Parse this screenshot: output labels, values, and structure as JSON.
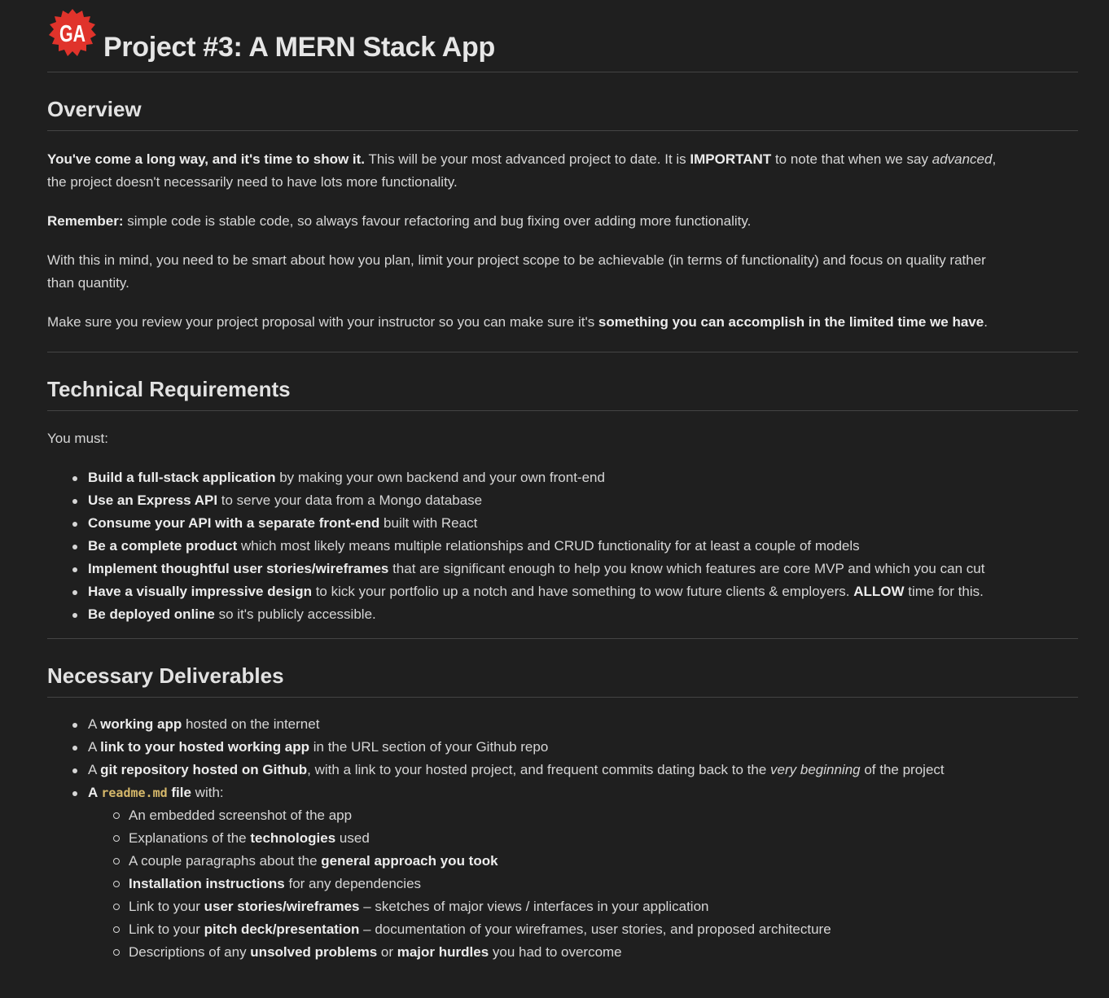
{
  "header": {
    "title": "Project #3: A MERN Stack App",
    "logo_icon": "ga-badge-icon",
    "logo_text": "GA",
    "logo_color": "#e0332b"
  },
  "overview": {
    "heading": "Overview",
    "p1": {
      "bold_lead": "You've come a long way, and it's time to show it.",
      "text_a": " This will be your most advanced project to date. It is ",
      "bold_important": "IMPORTANT",
      "text_b": " to note that when we say ",
      "italic_advanced": "advanced",
      "text_c": ",",
      "line2": "the project doesn't necessarily need to have lots more functionality."
    },
    "p2": {
      "bold_lead": "Remember:",
      "text": " simple code is stable code, so always favour refactoring and bug fixing over adding more functionality."
    },
    "p3": {
      "line1": "With this in mind, you need to be smart about how you plan, limit your project scope to be achievable (in terms of functionality) and focus on quality rather",
      "line2": "than quantity."
    },
    "p4": {
      "text": "Make sure you review your project proposal with your instructor so you can make sure it's ",
      "bold": "something you can accomplish in the limited time we have",
      "end": "."
    }
  },
  "technical": {
    "heading": "Technical Requirements",
    "intro": "You must:",
    "items": [
      {
        "bold": "Build a full-stack application",
        "text": " by making your own backend and your own front-end"
      },
      {
        "bold": "Use an Express API",
        "text": " to serve your data from a Mongo database"
      },
      {
        "bold": "Consume your API with a separate front-end",
        "text": " built with React"
      },
      {
        "bold": "Be a complete product",
        "text": " which most likely means multiple relationships and CRUD functionality for at least a couple of models"
      },
      {
        "bold": "Implement thoughtful user stories/wireframes",
        "text": " that are significant enough to help you know which features are core MVP and which you can cut"
      },
      {
        "bold": "Have a visually impressive design",
        "text": " to kick your portfolio up a notch and have something to wow future clients & employers. ",
        "bold2": "ALLOW",
        "text2": " time for this."
      },
      {
        "bold": "Be deployed online",
        "text": " so it's publicly accessible."
      }
    ]
  },
  "deliverables": {
    "heading": "Necessary Deliverables",
    "items": [
      {
        "pre": "A ",
        "bold": "working app",
        "text": " hosted on the internet"
      },
      {
        "pre": "A ",
        "bold": "link to your hosted working app",
        "text": " in the URL section of your Github repo"
      },
      {
        "pre": "A ",
        "bold": "git repository hosted on Github",
        "text": ", with a link to your hosted project, and frequent commits dating back to the ",
        "italic": "very beginning",
        "text2": " of the project"
      },
      {
        "pre": "A ",
        "code": "readme.md",
        "bold": " file",
        "text": " with:"
      }
    ],
    "sub_items": [
      {
        "text": "An embedded screenshot of the app"
      },
      {
        "pre": "Explanations of the ",
        "bold": "technologies",
        "text": " used"
      },
      {
        "pre": "A couple paragraphs about the ",
        "bold": "general approach you took",
        "text": ""
      },
      {
        "pre": "",
        "bold": "Installation instructions",
        "text": " for any dependencies"
      },
      {
        "pre": "Link to your ",
        "bold": "user stories/wireframes",
        "text": " – sketches of major views / interfaces in your application"
      },
      {
        "pre": "Link to your ",
        "bold": "pitch deck/presentation",
        "text": " – documentation of your wireframes, user stories, and proposed architecture"
      },
      {
        "pre": "Descriptions of any ",
        "bold": "unsolved problems",
        "mid": " or ",
        "bold2": "major hurdles",
        "text": " you had to overcome"
      }
    ]
  }
}
